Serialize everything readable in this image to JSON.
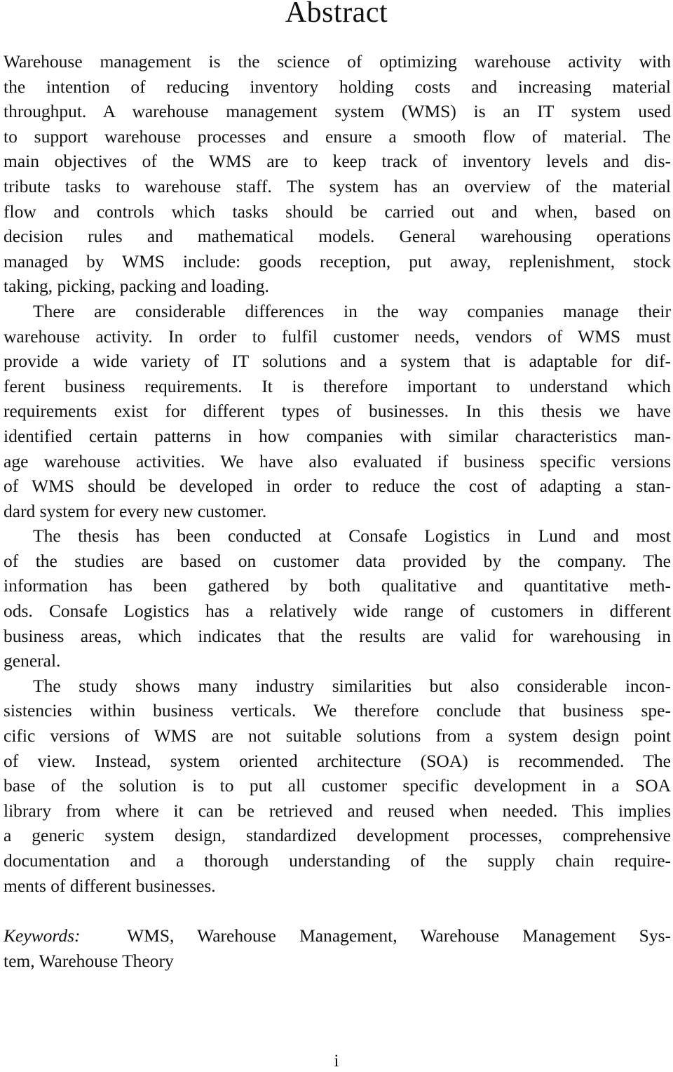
{
  "document": {
    "title": "Abstract",
    "paragraphs": [
      {
        "indent": false,
        "lines": [
          "Warehouse management is the science of optimizing warehouse activity with",
          "the intention of reducing inventory holding costs and increasing material",
          "throughput. A warehouse management system (WMS) is an IT system used",
          "to support warehouse processes and ensure a smooth flow of material. The",
          "main objectives of the WMS are to keep track of inventory levels and dis-",
          "tribute tasks to warehouse staff. The system has an overview of the material",
          "flow and controls which tasks should be carried out and when, based on",
          "decision rules and mathematical models. General warehousing operations",
          "managed by WMS include: goods reception, put away, replenishment, stock",
          "taking, picking, packing and loading."
        ]
      },
      {
        "indent": true,
        "lines": [
          "There are considerable differences in the way companies manage their",
          "warehouse activity. In order to fulfil customer needs, vendors of WMS must",
          "provide a wide variety of IT solutions and a system that is adaptable for dif-",
          "ferent business requirements. It is therefore important to understand which",
          "requirements exist for different types of businesses. In this thesis we have",
          "identified certain patterns in how companies with similar characteristics man-",
          "age warehouse activities. We have also evaluated if business specific versions",
          "of WMS should be developed in order to reduce the cost of adapting a stan-",
          "dard system for every new customer."
        ]
      },
      {
        "indent": true,
        "lines": [
          "The thesis has been conducted at Consafe Logistics in Lund and most",
          "of the studies are based on customer data provided by the company. The",
          "information has been gathered by both qualitative and quantitative meth-",
          "ods. Consafe Logistics has a relatively wide range of customers in different",
          "business areas, which indicates that the results are valid for warehousing in",
          "general."
        ]
      },
      {
        "indent": true,
        "lines": [
          "The study shows many industry similarities but also considerable incon-",
          "sistencies within business verticals. We therefore conclude that business spe-",
          "cific versions of WMS are not suitable solutions from a system design point",
          "of view. Instead, system oriented architecture (SOA) is recommended. The",
          "base of the solution is to put all customer specific development in a SOA",
          "library from where it can be retrieved and reused when needed. This implies",
          "a generic system design, standardized development processes, comprehensive",
          "documentation and a thorough understanding of the supply chain require-",
          "ments of different businesses."
        ]
      }
    ],
    "keywords": {
      "label": "Keywords:",
      "lines": [
        "WMS, Warehouse Management, Warehouse Management Sys-",
        "tem, Warehouse Theory"
      ]
    },
    "page_number": "i"
  }
}
